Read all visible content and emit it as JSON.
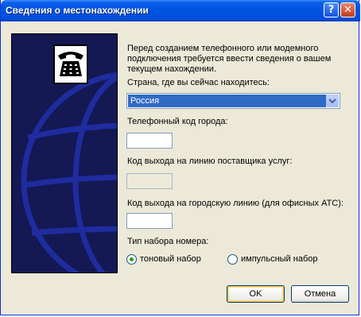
{
  "window": {
    "title": "Сведения о местонахождении",
    "help_glyph": "?",
    "close_glyph": "✕"
  },
  "intro_text": "Перед созданием телефонного или модемного\nподключения требуется ввести сведения о вашем\nтекущем нахождении.",
  "country": {
    "label": "Страна, где вы сейчас находитесь:",
    "value": "Россия"
  },
  "area_code": {
    "label": "Телефонный код города:",
    "value": ""
  },
  "carrier_code": {
    "label": "Код выхода на линию поставщика услуг:",
    "value": ""
  },
  "outside_line": {
    "label": "Код выхода на городскую линию (для офисных АТС):",
    "value": ""
  },
  "dialing": {
    "label": "Тип набора номера:",
    "tone_label": "тоновый набор",
    "pulse_label": "импульсный набор",
    "selected": "tone"
  },
  "buttons": {
    "ok": "OK",
    "cancel": "Отмена"
  },
  "colors": {
    "titlebar": "#0054E3",
    "dialog_bg": "#ECE9D8",
    "panel_bg": "#141853",
    "selection": "#316AC5"
  }
}
